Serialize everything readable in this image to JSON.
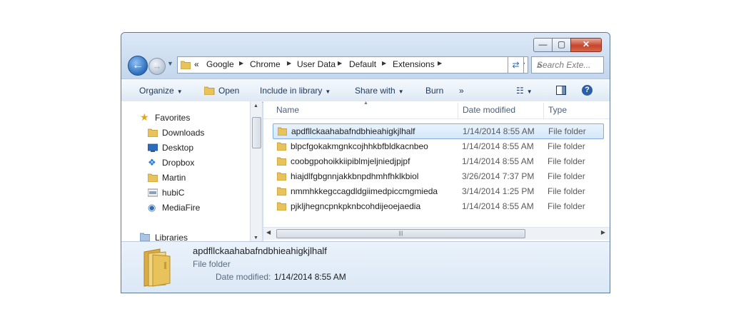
{
  "window": {
    "caption": {
      "minimize": "—",
      "maximize": "▢",
      "close": "✕"
    }
  },
  "address": {
    "overflow": "«",
    "crumbs": [
      "Google",
      "Chrome",
      "User Data",
      "Default",
      "Extensions"
    ]
  },
  "search": {
    "placeholder": "Search Exte..."
  },
  "toolbar": {
    "organize": "Organize",
    "open": "Open",
    "include": "Include in library",
    "share": "Share with",
    "burn": "Burn",
    "more": "»"
  },
  "nav": {
    "favorites": "Favorites",
    "items": [
      "Downloads",
      "Desktop",
      "Dropbox",
      "Martin",
      "hubiC",
      "MediaFire"
    ],
    "libraries": "Libraries"
  },
  "columns": {
    "name": "Name",
    "date": "Date modified",
    "type": "Type"
  },
  "files": [
    {
      "name": "apdfllckaahabafndbhieahigkjlhalf",
      "date": "1/14/2014 8:55 AM",
      "type": "File folder"
    },
    {
      "name": "blpcfgokakmgnkcojhhkbfbldkacnbeo",
      "date": "1/14/2014 8:55 AM",
      "type": "File folder"
    },
    {
      "name": "coobgpohoikkiipiblmjeljniedjpjpf",
      "date": "1/14/2014 8:55 AM",
      "type": "File folder"
    },
    {
      "name": "hiajdlfgbgnnjakkbnpdhmhfhklkbiol",
      "date": "3/26/2014 7:37 PM",
      "type": "File folder"
    },
    {
      "name": "nmmhkkegccagdldgiimedpiccmgmieda",
      "date": "3/14/2014 1:25 PM",
      "type": "File folder"
    },
    {
      "name": "pjkljhegncpnkpknbcohdijeoejaedia",
      "date": "1/14/2014 8:55 AM",
      "type": "File folder"
    }
  ],
  "details": {
    "name": "apdfllckaahabafndbhieahigkjlhalf",
    "type": "File folder",
    "date_label": "Date modified:",
    "date_value": "1/14/2014 8:55 AM"
  },
  "icons": {
    "folder_color": "#e8c25a",
    "accent": "#1e395b"
  }
}
